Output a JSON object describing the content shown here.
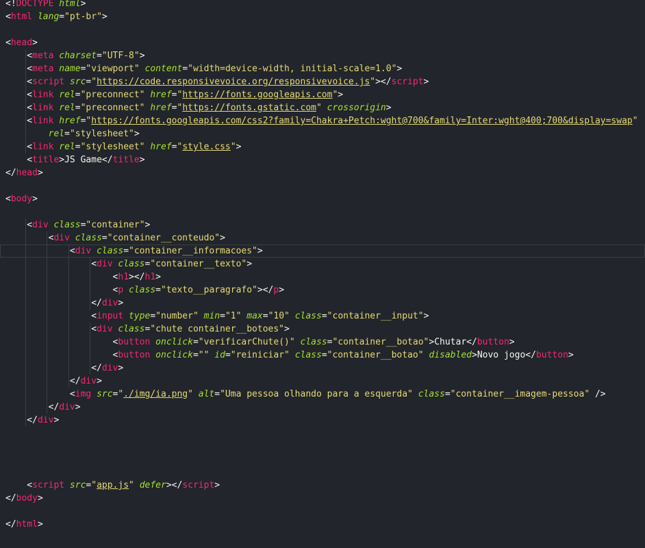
{
  "editor": {
    "language": "html",
    "active_line": 20,
    "colors": {
      "background": "#22252b",
      "tag": "#f92672",
      "attribute": "#a6e22e",
      "string": "#e6db74",
      "text": "#f8f8f2",
      "current_line_border": "#3a3e46"
    }
  },
  "code_lines": [
    [
      [
        "punc",
        "<!"
      ],
      [
        "tag",
        "DOCTYPE"
      ],
      [
        "punc",
        " "
      ],
      [
        "attr",
        "html"
      ],
      [
        "punc",
        ">"
      ]
    ],
    [
      [
        "punc",
        "<"
      ],
      [
        "tag",
        "html"
      ],
      [
        "punc",
        " "
      ],
      [
        "attr",
        "lang"
      ],
      [
        "punc",
        "="
      ],
      [
        "str",
        "\"pt-br\""
      ],
      [
        "punc",
        ">"
      ]
    ],
    [],
    [
      [
        "punc",
        "<"
      ],
      [
        "tag",
        "head"
      ],
      [
        "punc",
        ">"
      ]
    ],
    [
      [
        "punc",
        "    <"
      ],
      [
        "tag",
        "meta"
      ],
      [
        "punc",
        " "
      ],
      [
        "attr",
        "charset"
      ],
      [
        "punc",
        "="
      ],
      [
        "str",
        "\"UTF-8\""
      ],
      [
        "punc",
        ">"
      ]
    ],
    [
      [
        "punc",
        "    <"
      ],
      [
        "tag",
        "meta"
      ],
      [
        "punc",
        " "
      ],
      [
        "attr",
        "name"
      ],
      [
        "punc",
        "="
      ],
      [
        "str",
        "\"viewport\""
      ],
      [
        "punc",
        " "
      ],
      [
        "attr",
        "content"
      ],
      [
        "punc",
        "="
      ],
      [
        "str",
        "\"width=device-width, initial-scale=1.0\""
      ],
      [
        "punc",
        ">"
      ]
    ],
    [
      [
        "punc",
        "    <"
      ],
      [
        "tag",
        "script"
      ],
      [
        "punc",
        " "
      ],
      [
        "attr",
        "src"
      ],
      [
        "punc",
        "="
      ],
      [
        "str",
        "\""
      ],
      [
        "url",
        "https://code.responsivevoice.org/responsivevoice.js"
      ],
      [
        "str",
        "\""
      ],
      [
        "punc",
        "></"
      ],
      [
        "tag",
        "script"
      ],
      [
        "punc",
        ">"
      ]
    ],
    [
      [
        "punc",
        "    <"
      ],
      [
        "tag",
        "link"
      ],
      [
        "punc",
        " "
      ],
      [
        "attr",
        "rel"
      ],
      [
        "punc",
        "="
      ],
      [
        "str",
        "\"preconnect\""
      ],
      [
        "punc",
        " "
      ],
      [
        "attr",
        "href"
      ],
      [
        "punc",
        "="
      ],
      [
        "str",
        "\""
      ],
      [
        "url",
        "https://fonts.googleapis.com"
      ],
      [
        "str",
        "\""
      ],
      [
        "punc",
        ">"
      ]
    ],
    [
      [
        "punc",
        "    <"
      ],
      [
        "tag",
        "link"
      ],
      [
        "punc",
        " "
      ],
      [
        "attr",
        "rel"
      ],
      [
        "punc",
        "="
      ],
      [
        "str",
        "\"preconnect\""
      ],
      [
        "punc",
        " "
      ],
      [
        "attr",
        "href"
      ],
      [
        "punc",
        "="
      ],
      [
        "str",
        "\""
      ],
      [
        "url",
        "https://fonts.gstatic.com"
      ],
      [
        "str",
        "\""
      ],
      [
        "punc",
        " "
      ],
      [
        "attr",
        "crossorigin"
      ],
      [
        "punc",
        ">"
      ]
    ],
    [
      [
        "punc",
        "    <"
      ],
      [
        "tag",
        "link"
      ],
      [
        "punc",
        " "
      ],
      [
        "attr",
        "href"
      ],
      [
        "punc",
        "="
      ],
      [
        "str",
        "\""
      ],
      [
        "url",
        "https://fonts.googleapis.com/css2?family=Chakra+Petch:wght@700&family=Inter:wght@400;700&display=swap"
      ],
      [
        "str",
        "\""
      ]
    ],
    [
      [
        "punc",
        "        "
      ],
      [
        "attr",
        "rel"
      ],
      [
        "punc",
        "="
      ],
      [
        "str",
        "\"stylesheet\""
      ],
      [
        "punc",
        ">"
      ]
    ],
    [
      [
        "punc",
        "    <"
      ],
      [
        "tag",
        "link"
      ],
      [
        "punc",
        " "
      ],
      [
        "attr",
        "rel"
      ],
      [
        "punc",
        "="
      ],
      [
        "str",
        "\"stylesheet\""
      ],
      [
        "punc",
        " "
      ],
      [
        "attr",
        "href"
      ],
      [
        "punc",
        "="
      ],
      [
        "str",
        "\""
      ],
      [
        "url",
        "style.css"
      ],
      [
        "str",
        "\""
      ],
      [
        "punc",
        ">"
      ]
    ],
    [
      [
        "punc",
        "    <"
      ],
      [
        "tag",
        "title"
      ],
      [
        "punc",
        ">"
      ],
      [
        "text",
        "JS Game"
      ],
      [
        "punc",
        "</"
      ],
      [
        "tag",
        "title"
      ],
      [
        "punc",
        ">"
      ]
    ],
    [
      [
        "punc",
        "</"
      ],
      [
        "tag",
        "head"
      ],
      [
        "punc",
        ">"
      ]
    ],
    [],
    [
      [
        "punc",
        "<"
      ],
      [
        "tag",
        "body"
      ],
      [
        "punc",
        ">"
      ]
    ],
    [],
    [
      [
        "punc",
        "    <"
      ],
      [
        "tag",
        "div"
      ],
      [
        "punc",
        " "
      ],
      [
        "attr",
        "class"
      ],
      [
        "punc",
        "="
      ],
      [
        "str",
        "\"container\""
      ],
      [
        "punc",
        ">"
      ]
    ],
    [
      [
        "punc",
        "        <"
      ],
      [
        "tag",
        "div"
      ],
      [
        "punc",
        " "
      ],
      [
        "attr",
        "class"
      ],
      [
        "punc",
        "="
      ],
      [
        "str",
        "\"container__conteudo\""
      ],
      [
        "punc",
        ">"
      ]
    ],
    [
      [
        "punc",
        "            <"
      ],
      [
        "tag",
        "div"
      ],
      [
        "punc",
        " "
      ],
      [
        "attr",
        "class"
      ],
      [
        "punc",
        "="
      ],
      [
        "str",
        "\"container__informacoes\""
      ],
      [
        "punc",
        ">"
      ]
    ],
    [
      [
        "punc",
        "                <"
      ],
      [
        "tag",
        "div"
      ],
      [
        "punc",
        " "
      ],
      [
        "attr",
        "class"
      ],
      [
        "punc",
        "="
      ],
      [
        "str",
        "\"container__texto\""
      ],
      [
        "punc",
        ">"
      ]
    ],
    [
      [
        "punc",
        "                    <"
      ],
      [
        "tag",
        "h1"
      ],
      [
        "punc",
        "></"
      ],
      [
        "tag",
        "h1"
      ],
      [
        "punc",
        ">"
      ]
    ],
    [
      [
        "punc",
        "                    <"
      ],
      [
        "tag",
        "p"
      ],
      [
        "punc",
        " "
      ],
      [
        "attr",
        "class"
      ],
      [
        "punc",
        "="
      ],
      [
        "str",
        "\"texto__paragrafo\""
      ],
      [
        "punc",
        "></"
      ],
      [
        "tag",
        "p"
      ],
      [
        "punc",
        ">"
      ]
    ],
    [
      [
        "punc",
        "                </"
      ],
      [
        "tag",
        "div"
      ],
      [
        "punc",
        ">"
      ]
    ],
    [
      [
        "punc",
        "                <"
      ],
      [
        "tag",
        "input"
      ],
      [
        "punc",
        " "
      ],
      [
        "attr",
        "type"
      ],
      [
        "punc",
        "="
      ],
      [
        "str",
        "\"number\""
      ],
      [
        "punc",
        " "
      ],
      [
        "attr",
        "min"
      ],
      [
        "punc",
        "="
      ],
      [
        "str",
        "\"1\""
      ],
      [
        "punc",
        " "
      ],
      [
        "attr",
        "max"
      ],
      [
        "punc",
        "="
      ],
      [
        "str",
        "\"10\""
      ],
      [
        "punc",
        " "
      ],
      [
        "attr",
        "class"
      ],
      [
        "punc",
        "="
      ],
      [
        "str",
        "\"container__input\""
      ],
      [
        "punc",
        ">"
      ]
    ],
    [
      [
        "punc",
        "                <"
      ],
      [
        "tag",
        "div"
      ],
      [
        "punc",
        " "
      ],
      [
        "attr",
        "class"
      ],
      [
        "punc",
        "="
      ],
      [
        "str",
        "\"chute container__botoes\""
      ],
      [
        "punc",
        ">"
      ]
    ],
    [
      [
        "punc",
        "                    <"
      ],
      [
        "tag",
        "button"
      ],
      [
        "punc",
        " "
      ],
      [
        "attr",
        "onclick"
      ],
      [
        "punc",
        "="
      ],
      [
        "str",
        "\"verificarChute()\""
      ],
      [
        "punc",
        " "
      ],
      [
        "attr",
        "class"
      ],
      [
        "punc",
        "="
      ],
      [
        "str",
        "\"container__botao\""
      ],
      [
        "punc",
        ">"
      ],
      [
        "text",
        "Chutar"
      ],
      [
        "punc",
        "</"
      ],
      [
        "tag",
        "button"
      ],
      [
        "punc",
        ">"
      ]
    ],
    [
      [
        "punc",
        "                    <"
      ],
      [
        "tag",
        "button"
      ],
      [
        "punc",
        " "
      ],
      [
        "attr",
        "onclick"
      ],
      [
        "punc",
        "="
      ],
      [
        "str",
        "\"\""
      ],
      [
        "punc",
        " "
      ],
      [
        "attr",
        "id"
      ],
      [
        "punc",
        "="
      ],
      [
        "str",
        "\"reiniciar\""
      ],
      [
        "punc",
        " "
      ],
      [
        "attr",
        "class"
      ],
      [
        "punc",
        "="
      ],
      [
        "str",
        "\"container__botao\""
      ],
      [
        "punc",
        " "
      ],
      [
        "attr",
        "disabled"
      ],
      [
        "punc",
        ">"
      ],
      [
        "text",
        "Novo jogo"
      ],
      [
        "punc",
        "</"
      ],
      [
        "tag",
        "button"
      ],
      [
        "punc",
        ">"
      ]
    ],
    [
      [
        "punc",
        "                </"
      ],
      [
        "tag",
        "div"
      ],
      [
        "punc",
        ">"
      ]
    ],
    [
      [
        "punc",
        "            </"
      ],
      [
        "tag",
        "div"
      ],
      [
        "punc",
        ">"
      ]
    ],
    [
      [
        "punc",
        "            <"
      ],
      [
        "tag",
        "img"
      ],
      [
        "punc",
        " "
      ],
      [
        "attr",
        "src"
      ],
      [
        "punc",
        "="
      ],
      [
        "str",
        "\""
      ],
      [
        "url",
        "./img/ia.png"
      ],
      [
        "str",
        "\""
      ],
      [
        "punc",
        " "
      ],
      [
        "attr",
        "alt"
      ],
      [
        "punc",
        "="
      ],
      [
        "str",
        "\"Uma pessoa olhando para a esquerda\""
      ],
      [
        "punc",
        " "
      ],
      [
        "attr",
        "class"
      ],
      [
        "punc",
        "="
      ],
      [
        "str",
        "\"container__imagem-pessoa\""
      ],
      [
        "punc",
        " />"
      ]
    ],
    [
      [
        "punc",
        "        </"
      ],
      [
        "tag",
        "div"
      ],
      [
        "punc",
        ">"
      ]
    ],
    [
      [
        "punc",
        "    </"
      ],
      [
        "tag",
        "div"
      ],
      [
        "punc",
        ">"
      ]
    ],
    [],
    [],
    [],
    [],
    [
      [
        "punc",
        "    <"
      ],
      [
        "tag",
        "script"
      ],
      [
        "punc",
        " "
      ],
      [
        "attr",
        "src"
      ],
      [
        "punc",
        "="
      ],
      [
        "str",
        "\""
      ],
      [
        "url",
        "app.js"
      ],
      [
        "str",
        "\""
      ],
      [
        "punc",
        " "
      ],
      [
        "attr",
        "defer"
      ],
      [
        "punc",
        "></"
      ],
      [
        "tag",
        "script"
      ],
      [
        "punc",
        ">"
      ]
    ],
    [
      [
        "punc",
        "</"
      ],
      [
        "tag",
        "body"
      ],
      [
        "punc",
        ">"
      ]
    ],
    [],
    [
      [
        "punc",
        "</"
      ],
      [
        "tag",
        "html"
      ],
      [
        "punc",
        ">"
      ]
    ]
  ]
}
